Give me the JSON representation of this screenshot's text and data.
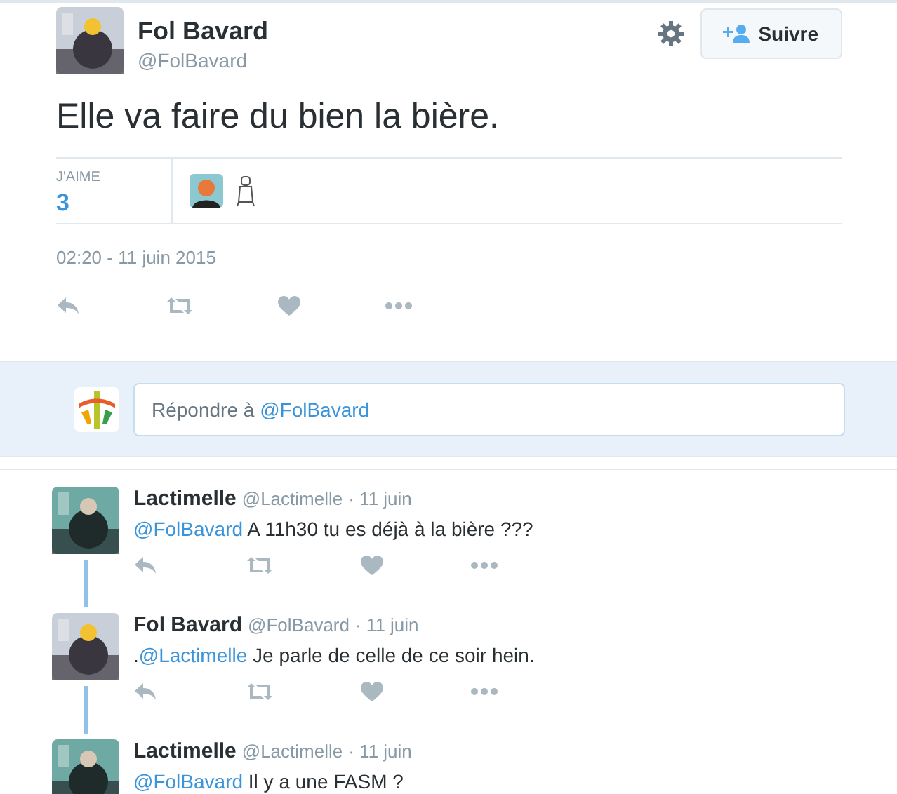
{
  "tweet": {
    "name": "Fol Bavard",
    "handle": "@FolBavard",
    "follow_label": "Suivre",
    "text": "Elle va faire du bien la bière.",
    "likes_label": "J'AIME",
    "likes_count": "3",
    "timestamp": "02:20 - 11 juin 2015"
  },
  "reply_box": {
    "prompt": "Répondre à ",
    "mention": "@FolBavard"
  },
  "replies": [
    {
      "name": "Lactimelle",
      "handle": "@Lactimelle",
      "date": "· 11 juin",
      "mention": "@FolBavard",
      "text": " A 11h30 tu es déjà à la bière ???",
      "thread_below": true
    },
    {
      "name": "Fol Bavard",
      "handle": "@FolBavard",
      "date": "· 11 juin",
      "prefix": ".",
      "mention": "@Lactimelle",
      "text": " Je parle de celle de ce soir hein.",
      "thread_below": true
    },
    {
      "name": "Lactimelle",
      "handle": "@Lactimelle",
      "date": "· 11 juin",
      "mention": "@FolBavard",
      "text": " Il y a une FASM ?",
      "thread_below": false
    }
  ]
}
